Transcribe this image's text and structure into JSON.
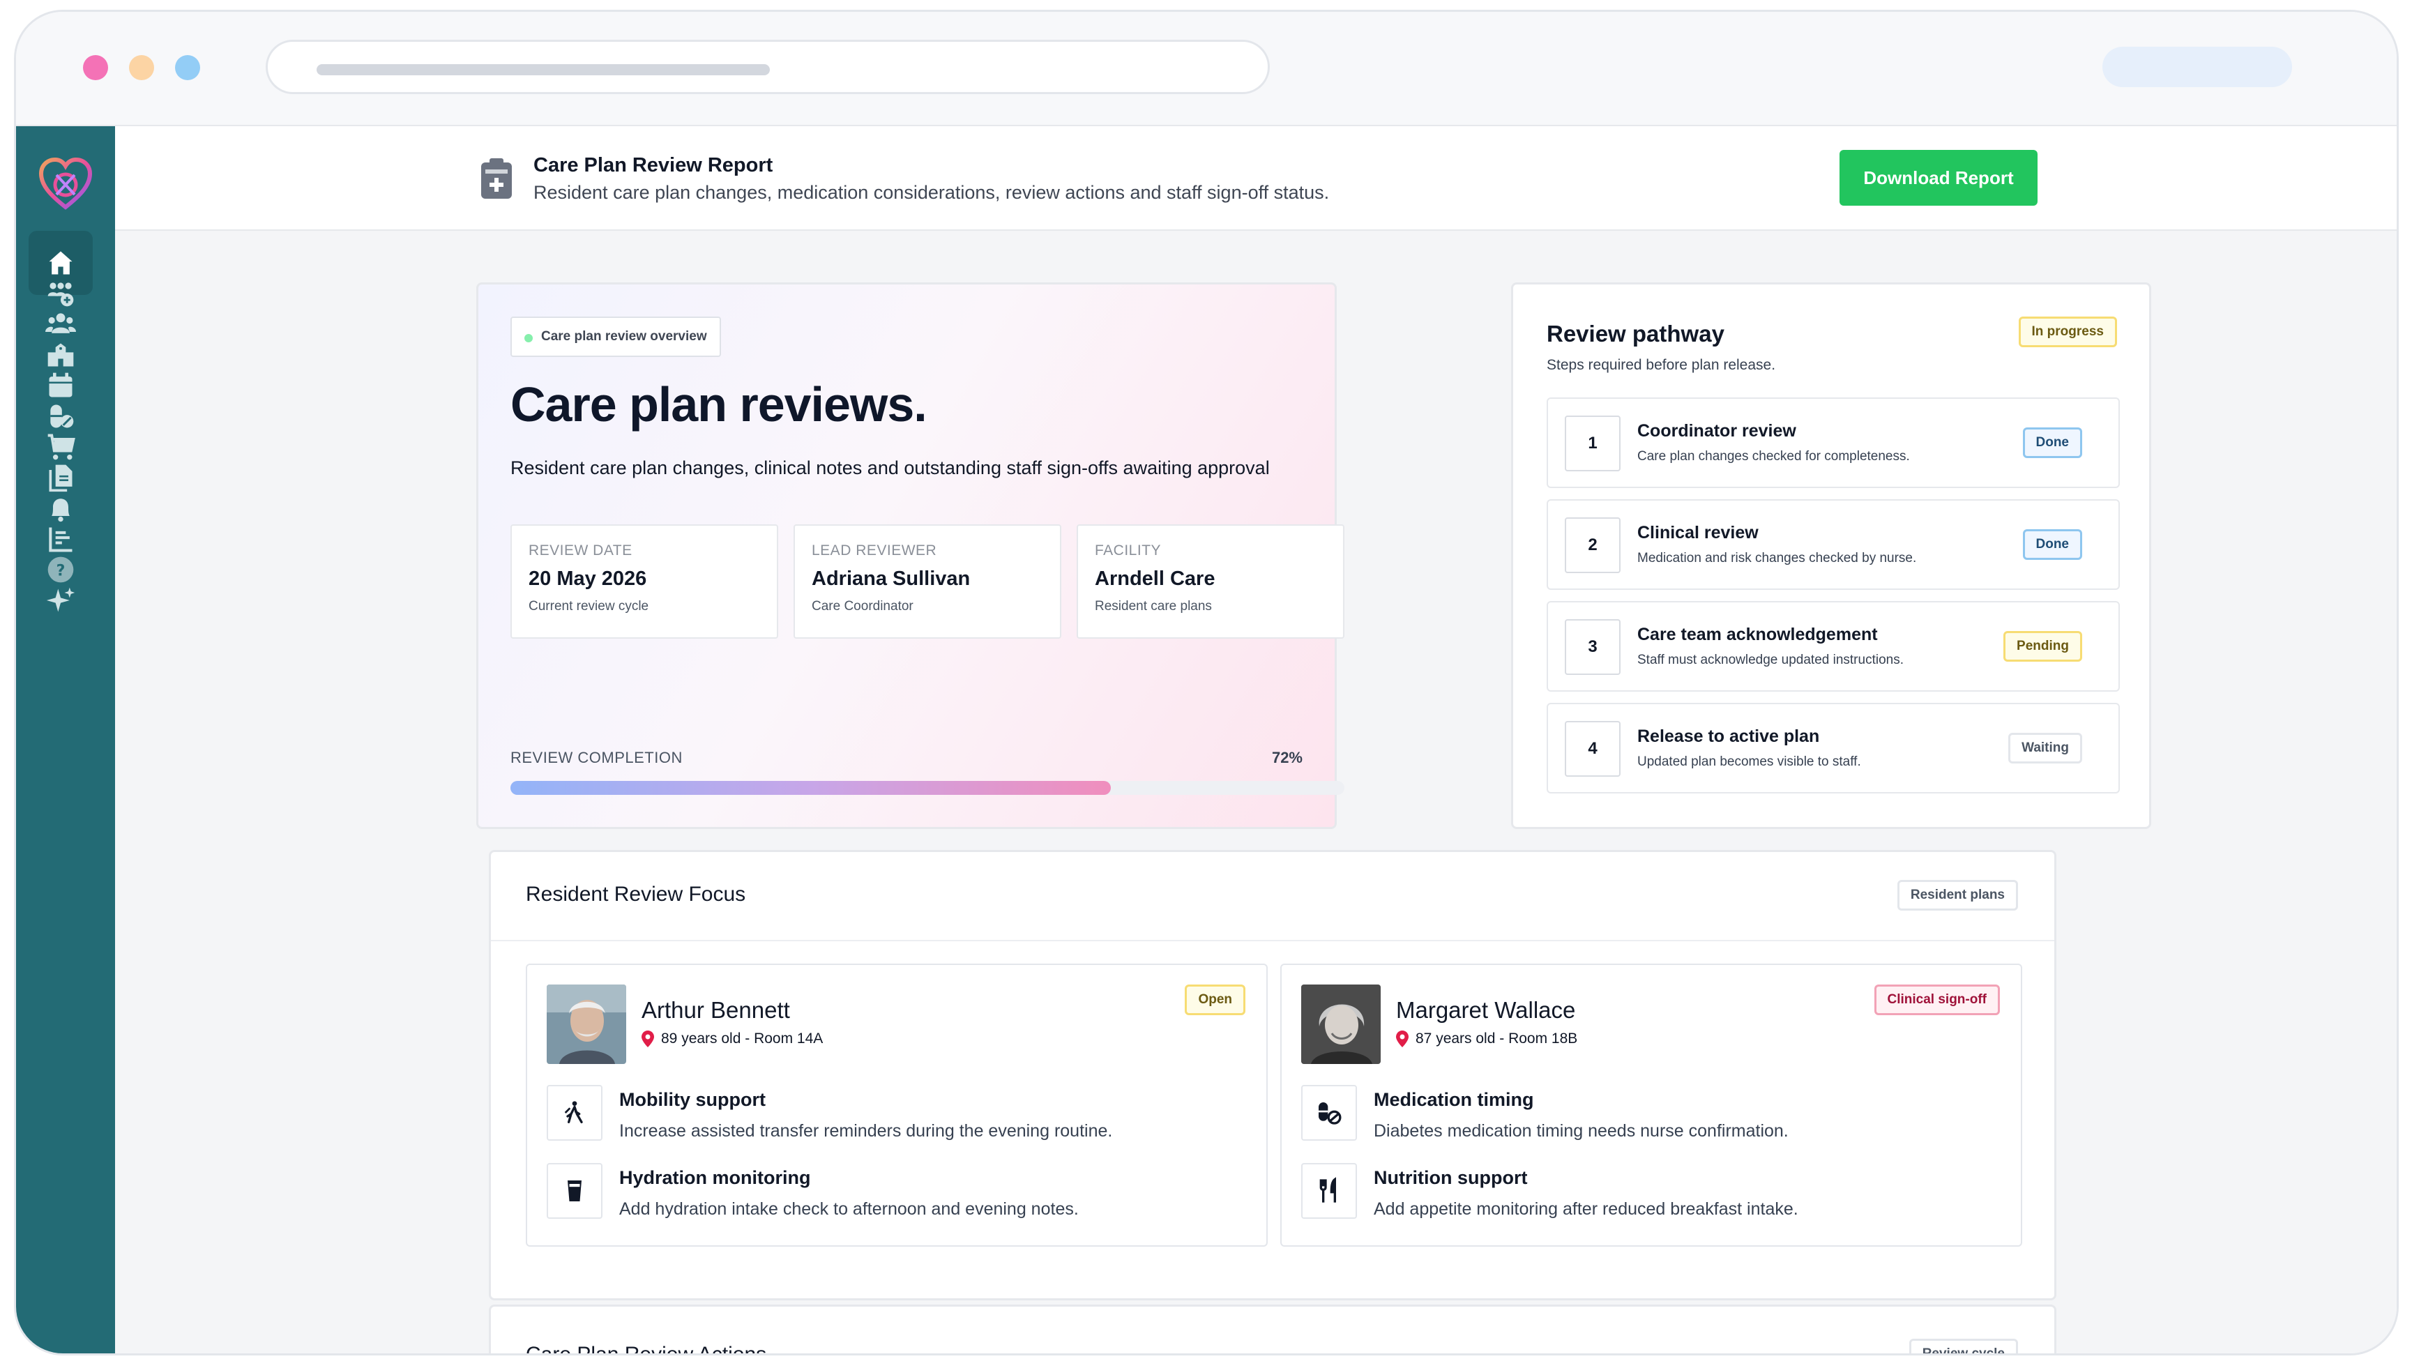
{
  "header": {
    "title": "Care Plan Review Report",
    "subtitle": "Resident care plan changes, medication considerations, review actions and staff sign-off status.",
    "download_label": "Download Report"
  },
  "sidebar": {
    "items": [
      {
        "icon": "home-icon",
        "active": true
      },
      {
        "icon": "add-group-icon"
      },
      {
        "icon": "users-icon"
      },
      {
        "icon": "building-icon"
      },
      {
        "icon": "calendar-icon"
      },
      {
        "icon": "medication-icon"
      },
      {
        "icon": "cart-icon"
      },
      {
        "icon": "documents-icon"
      },
      {
        "icon": "bell-icon"
      },
      {
        "icon": "reports-icon"
      },
      {
        "icon": "help-icon"
      },
      {
        "icon": "sparkle-icon"
      }
    ]
  },
  "overview": {
    "chip": "Care plan review overview",
    "title": "Care plan reviews.",
    "description": "Resident care plan changes, clinical notes and outstanding staff sign-offs awaiting approval",
    "info": [
      {
        "label": "REVIEW DATE",
        "value": "20 May 2026",
        "sub": "Current review cycle"
      },
      {
        "label": "LEAD REVIEWER",
        "value": "Adriana Sullivan",
        "sub": "Care Coordinator"
      },
      {
        "label": "FACILITY",
        "value": "Arndell Care",
        "sub": "Resident care plans"
      }
    ],
    "progress_label": "REVIEW COMPLETION",
    "progress_value": "72%",
    "progress_fraction": 0.72
  },
  "pathway": {
    "title": "Review pathway",
    "subtitle": "Steps required before plan release.",
    "status": "In progress",
    "steps": [
      {
        "num": "1",
        "title": "Coordinator review",
        "desc": "Care plan changes checked for completeness.",
        "status": "Done"
      },
      {
        "num": "2",
        "title": "Clinical review",
        "desc": "Medication and risk changes checked by nurse.",
        "status": "Done"
      },
      {
        "num": "3",
        "title": "Care team acknowledgement",
        "desc": "Staff must acknowledge updated instructions.",
        "status": "Pending"
      },
      {
        "num": "4",
        "title": "Release to active plan",
        "desc": "Updated plan becomes visible to staff.",
        "status": "Waiting"
      }
    ]
  },
  "focus": {
    "title": "Resident Review Focus",
    "badge": "Resident plans",
    "residents": [
      {
        "name": "Arthur Bennett",
        "meta": "89 years old - Room 14A",
        "status": "Open",
        "needs": [
          {
            "icon": "walking-icon",
            "title": "Mobility support",
            "desc": "Increase assisted transfer reminders during the evening routine."
          },
          {
            "icon": "cup-icon",
            "title": "Hydration monitoring",
            "desc": "Add hydration intake check to afternoon and evening notes."
          }
        ]
      },
      {
        "name": "Margaret Wallace",
        "meta": "87 years old - Room 18B",
        "status": "Clinical sign-off",
        "needs": [
          {
            "icon": "pills-icon",
            "title": "Medication timing",
            "desc": "Diabetes medication timing needs nurse confirmation."
          },
          {
            "icon": "utensils-icon",
            "title": "Nutrition support",
            "desc": "Add appetite monitoring after reduced breakfast intake."
          }
        ]
      }
    ]
  },
  "actions": {
    "title": "Care Plan Review Actions",
    "badge": "Review cycle"
  },
  "colors": {
    "sidebar": "#236b75",
    "accent_green": "#22c55e",
    "pending_yellow": "#f7dc73",
    "done_blue": "#8ec6ef",
    "signoff_red": "#f2a2b6"
  }
}
